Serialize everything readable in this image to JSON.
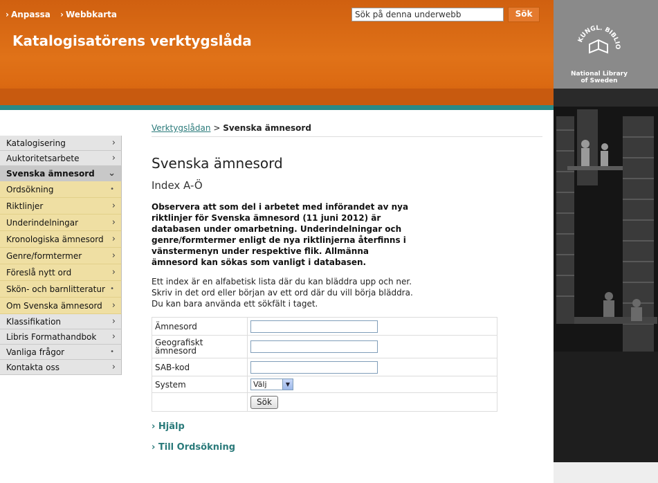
{
  "header": {
    "links": [
      "Anpassa",
      "Webbkarta"
    ],
    "site_title": "Katalogisatörens verktygslåda",
    "search_placeholder": "Sök på denna underwebb",
    "search_button": "Sök"
  },
  "logo": {
    "line1": "National Library",
    "line2": "of Sweden",
    "seal_text": "KUNGL. BIBLIOTEKET"
  },
  "breadcrumb": {
    "link": "Verktygslådan",
    "separator": ">",
    "current": "Svenska ämnesord"
  },
  "nav": {
    "items": [
      {
        "label": "Katalogisering",
        "marker": "›",
        "type": "top"
      },
      {
        "label": "Auktoritetsarbete",
        "marker": "›",
        "type": "top"
      },
      {
        "label": "Svenska ämnesord",
        "marker": "⌄",
        "type": "current"
      },
      {
        "label": "Ordsökning",
        "marker": "•",
        "type": "sub"
      },
      {
        "label": "Riktlinjer",
        "marker": "›",
        "type": "sub"
      },
      {
        "label": "Underindelningar",
        "marker": "›",
        "type": "sub"
      },
      {
        "label": "Kronologiska ämnesord",
        "marker": "›",
        "type": "sub"
      },
      {
        "label": "Genre/formtermer",
        "marker": "›",
        "type": "sub"
      },
      {
        "label": "Föreslå nytt ord",
        "marker": "›",
        "type": "sub"
      },
      {
        "label": "Skön- och barnlitteratur",
        "marker": "•",
        "type": "sub"
      },
      {
        "label": "Om Svenska ämnesord",
        "marker": "›",
        "type": "sub"
      },
      {
        "label": "Klassifikation",
        "marker": "›",
        "type": "top"
      },
      {
        "label": "Libris Formathandbok",
        "marker": "›",
        "type": "top"
      },
      {
        "label": "Vanliga frågor",
        "marker": "•",
        "type": "top"
      },
      {
        "label": "Kontakta oss",
        "marker": "›",
        "type": "top"
      }
    ]
  },
  "main": {
    "title": "Svenska ämnesord",
    "subtitle": "Index A-Ö",
    "notice": "Observera att som del i arbetet med införandet av nya riktlinjer för Svenska ämnesord (11 juni 2012) är databasen under omarbetning. Underindelningar och genre/formtermer enligt de nya riktlinjerna återfinns i vänstermenyn under respektive flik. Allmänna ämnesord kan sökas som vanligt i databasen.",
    "info": " Ett index är en alfabetisk lista där du kan bläddra upp och ner. Skriv in det ord eller början av ett ord där du vill börja bläddra. Du kan bara använda ett sökfält i taget."
  },
  "form": {
    "fields": [
      {
        "label": "Ämnesord",
        "value": ""
      },
      {
        "label": "Geografiskt ämnesord",
        "value": ""
      },
      {
        "label": "SAB-kod",
        "value": ""
      }
    ],
    "system_label": "System",
    "system_selected": "Välj",
    "submit": "Sök"
  },
  "links": {
    "help": "Hjälp",
    "to_search": "Till Ordsökning"
  },
  "colors": {
    "header_orange": "#e07218",
    "teal": "#2a8a87",
    "nav_sub_bg": "#efdfa3"
  }
}
